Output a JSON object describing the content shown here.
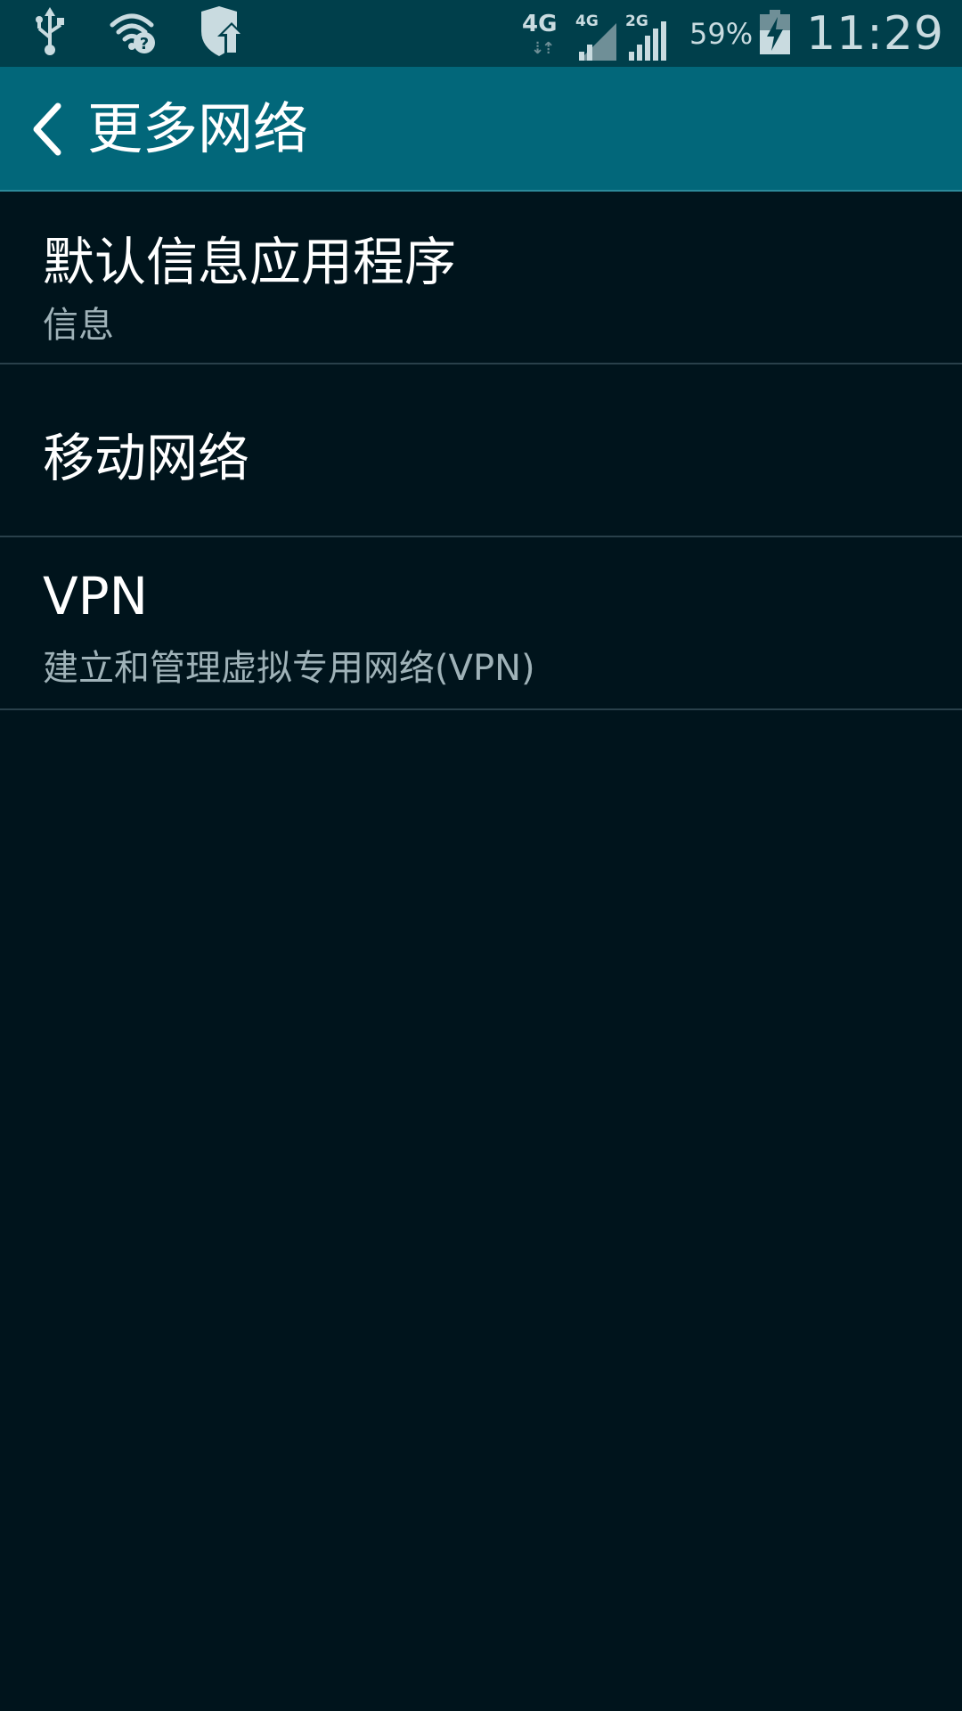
{
  "status_bar": {
    "icons_left": [
      "usb-icon",
      "wifi-unknown-icon",
      "shield-update-icon"
    ],
    "network_main": "4G",
    "sim1_type": "4G",
    "sim2_type": "2G",
    "battery_percent": "59%",
    "time": "11:29"
  },
  "header": {
    "title": "更多网络"
  },
  "items": [
    {
      "title": "默认信息应用程序",
      "subtitle": "信息"
    },
    {
      "title": "移动网络",
      "subtitle": ""
    },
    {
      "title": "VPN",
      "subtitle": "建立和管理虚拟专用网络(VPN)"
    }
  ],
  "colors": {
    "status_bar": "#003f4b",
    "action_bar": "#02677a",
    "background": "#00141c",
    "divider": "#29404a"
  }
}
